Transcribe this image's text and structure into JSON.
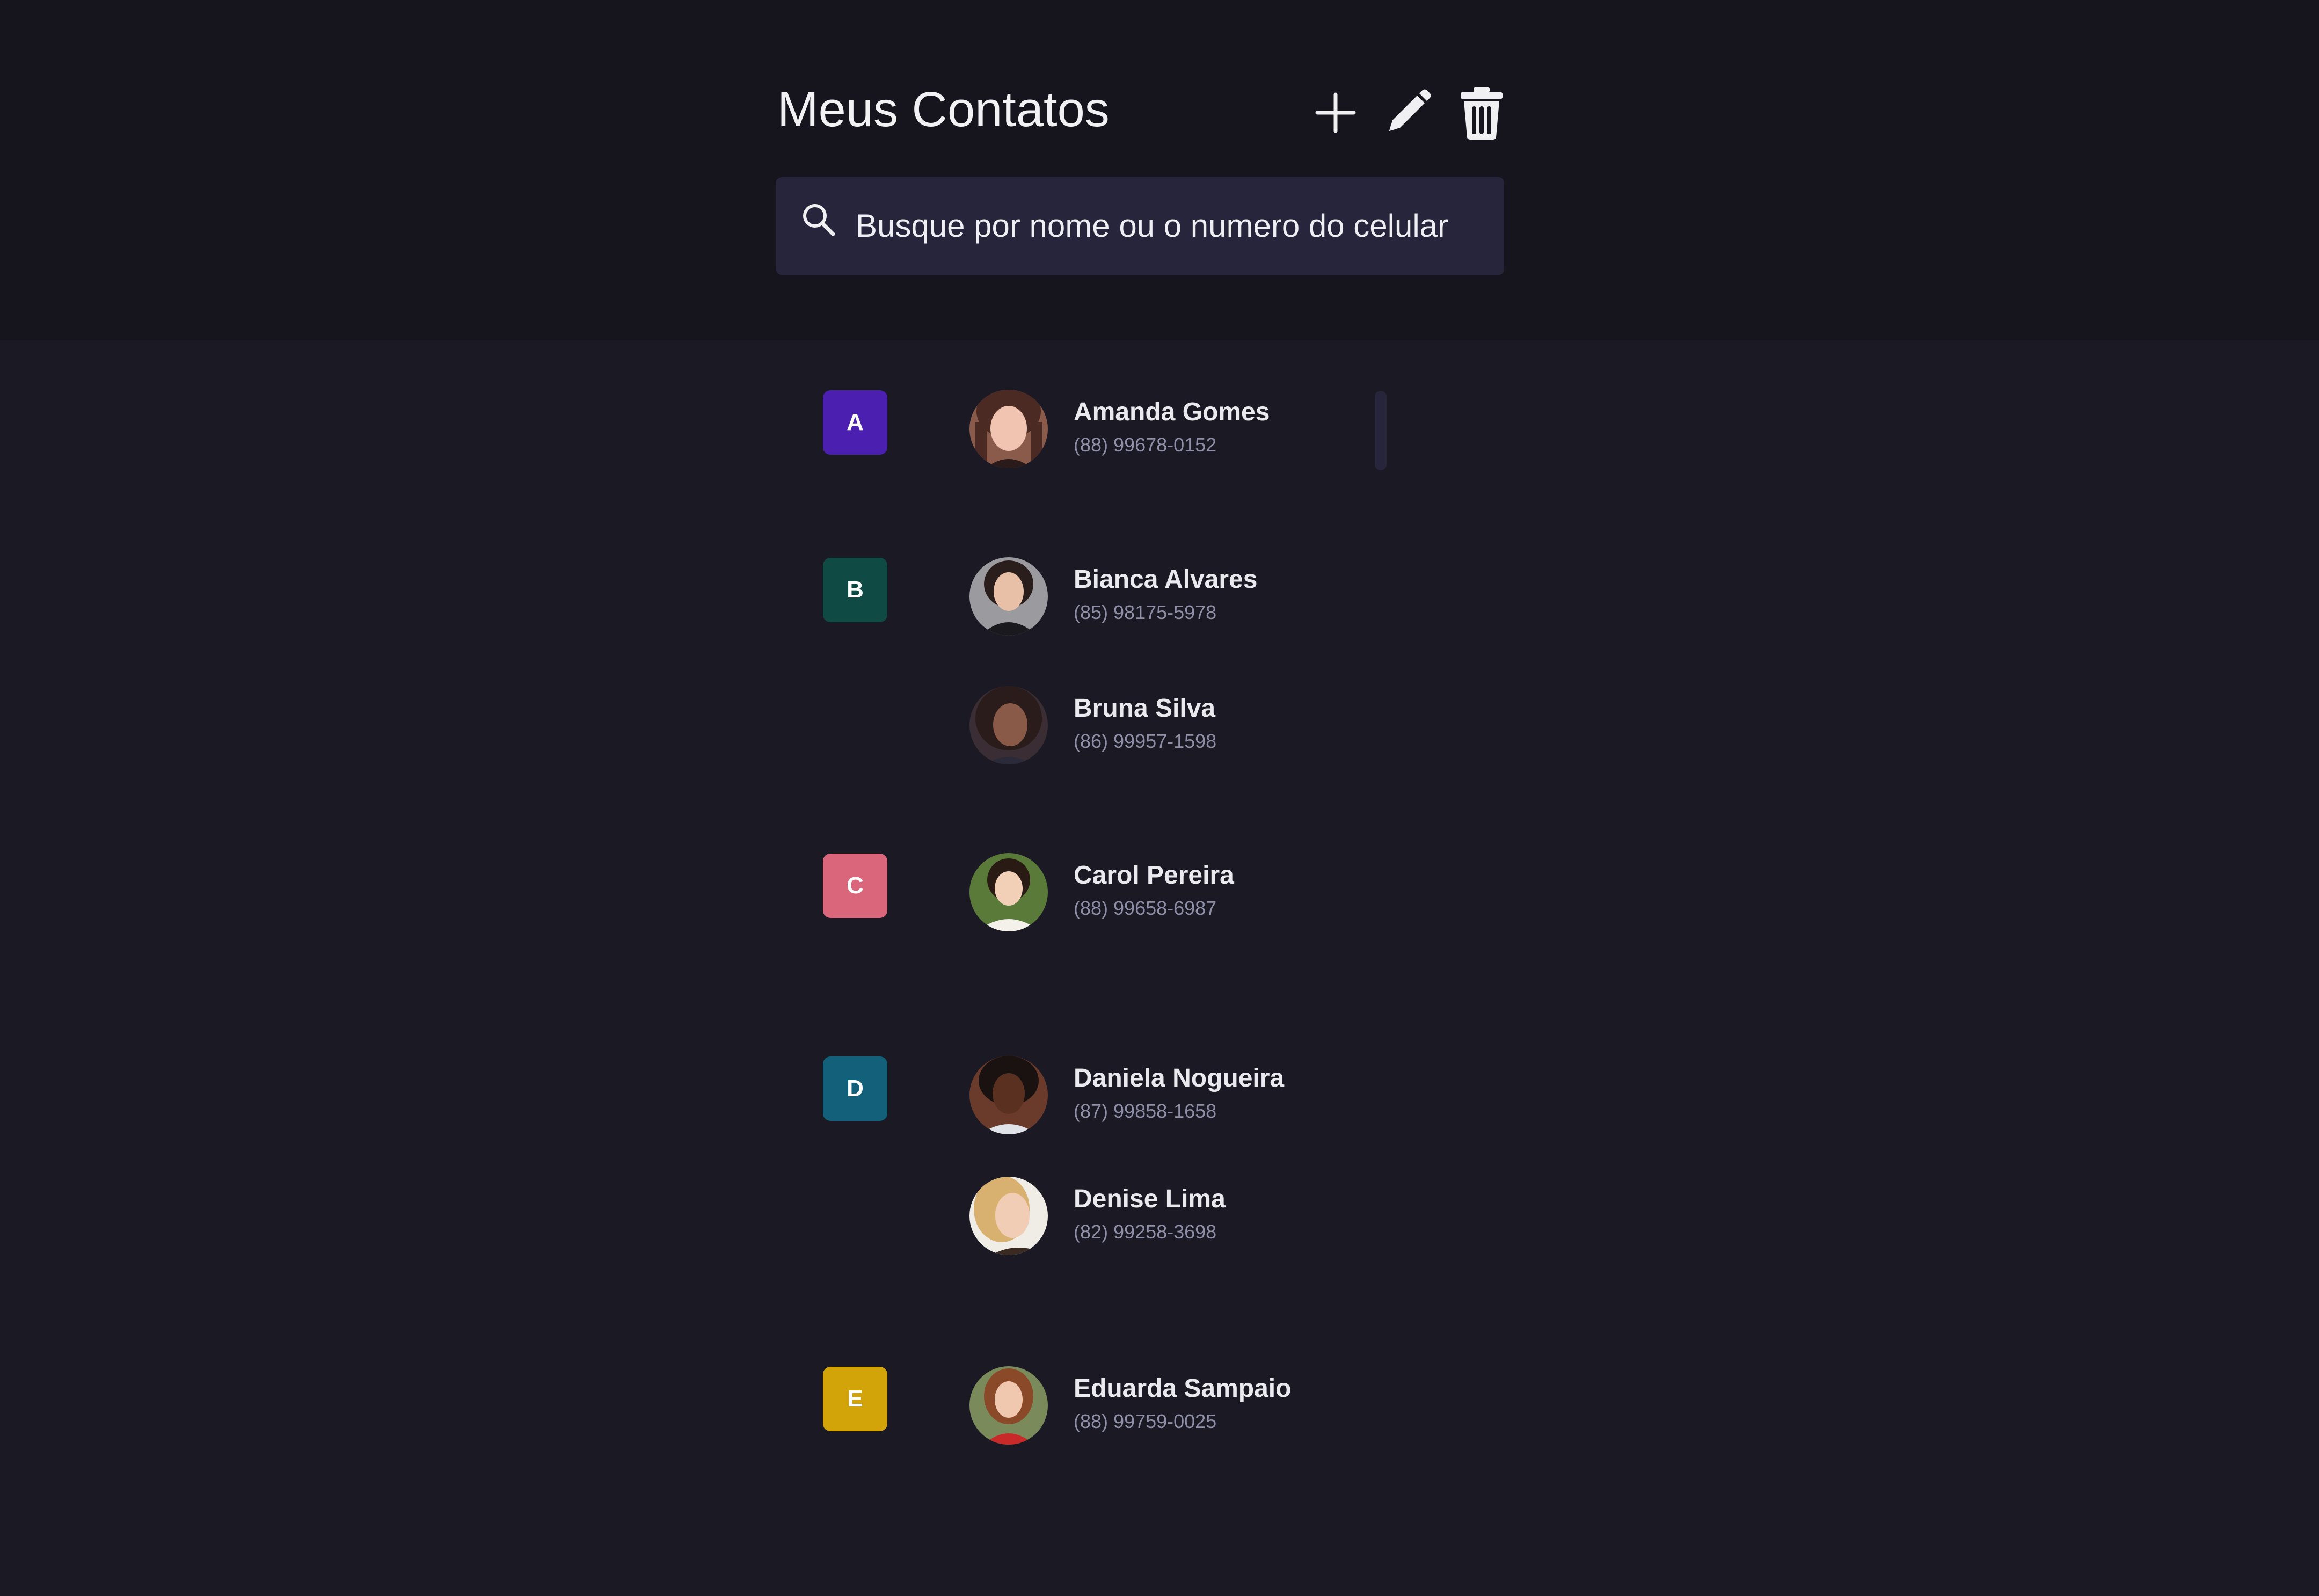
{
  "header": {
    "title": "Meus Contatos",
    "actions": {
      "add_icon": "plus-icon",
      "edit_icon": "pencil-icon",
      "delete_icon": "trash-icon"
    }
  },
  "search": {
    "placeholder": "Busque por nome ou o numero do celular",
    "value": "",
    "icon": "search-icon"
  },
  "groups": [
    {
      "letter": "A",
      "color": "#4b1fb0",
      "contacts": [
        {
          "name": "Amanda Gomes",
          "phone": "(88) 99678-0152"
        }
      ]
    },
    {
      "letter": "B",
      "color": "#0f4a44",
      "contacts": [
        {
          "name": "Bianca Alvares",
          "phone": "(85) 98175-5978"
        },
        {
          "name": "Bruna Silva",
          "phone": "(86) 99957-1598"
        }
      ]
    },
    {
      "letter": "C",
      "color": "#d9667a",
      "contacts": [
        {
          "name": "Carol Pereira",
          "phone": "(88) 99658-6987"
        }
      ]
    },
    {
      "letter": "D",
      "color": "#12607a",
      "contacts": [
        {
          "name": "Daniela Nogueira",
          "phone": "(87) 99858-1658"
        },
        {
          "name": "Denise Lima",
          "phone": "(82) 99258-3698"
        }
      ]
    },
    {
      "letter": "E",
      "color": "#d2a40a",
      "contacts": [
        {
          "name": "Eduarda Sampaio",
          "phone": "(88) 99759-0025"
        }
      ]
    }
  ],
  "colors": {
    "background": "#1b1a24",
    "header_background": "#16151d",
    "search_background": "#26253b"
  }
}
